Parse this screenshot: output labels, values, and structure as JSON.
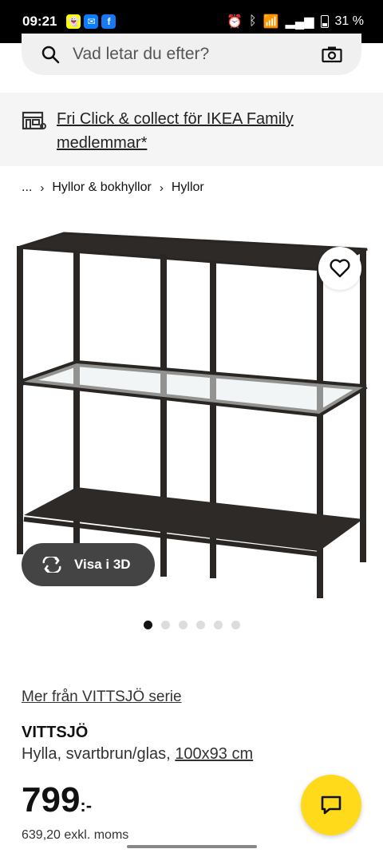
{
  "status_bar": {
    "time": "09:21",
    "battery": "31 %",
    "icons": [
      "snapchat-icon",
      "messenger-icon",
      "facebook-icon",
      "alarm-icon",
      "bluetooth-icon",
      "wifi-icon",
      "signal-icon",
      "battery-icon"
    ]
  },
  "search": {
    "placeholder": "Vad letar du efter?"
  },
  "promo": {
    "text": "Fri Click & collect för IKEA Family medlemmar*"
  },
  "breadcrumb": {
    "ellipsis": "...",
    "items": [
      "Hyllor & bokhyllor",
      "Hyllor"
    ]
  },
  "product": {
    "image_count": 6,
    "active_image": 1,
    "view3d_label": "Visa i 3D",
    "series_link": "Mer från VITTSJÖ serie",
    "name": "VITTSJÖ",
    "description": "Hylla, svartbrun/glas,",
    "dimensions": "100x93 cm",
    "price": "799",
    "price_suffix": ":-",
    "price_excl": "639,20 exkl. moms"
  },
  "colors": {
    "accent_yellow": "#ffda1a",
    "button_dark": "#444444",
    "promo_bg": "#f5f5f5"
  }
}
